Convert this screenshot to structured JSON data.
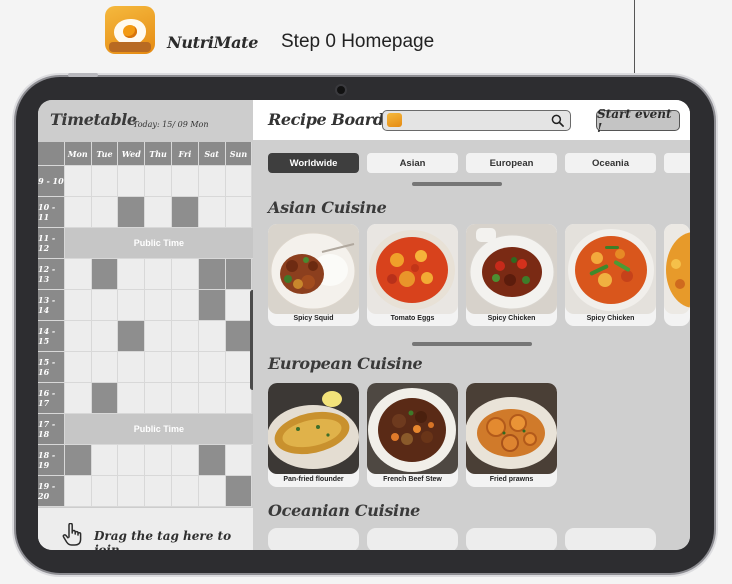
{
  "header": {
    "app_name": "NutriMate",
    "step_title": "Step 0  Homepage"
  },
  "timetable": {
    "title": "Timetable",
    "today": "Today: 15/ 09 Mon",
    "days": [
      "Mon",
      "Tue",
      "Wed",
      "Thu",
      "Fri",
      "Sat",
      "Sun"
    ],
    "public_label": "Public Time",
    "rows": [
      {
        "time": "9 - 10",
        "cells": [
          0,
          0,
          0,
          0,
          0,
          0,
          0
        ]
      },
      {
        "time": "10 - 11",
        "cells": [
          0,
          0,
          1,
          0,
          1,
          0,
          0
        ]
      },
      {
        "time": "11 - 12",
        "public": true
      },
      {
        "time": "12 - 13",
        "cells": [
          0,
          1,
          0,
          0,
          0,
          1,
          1
        ]
      },
      {
        "time": "13 - 14",
        "cells": [
          0,
          0,
          0,
          0,
          0,
          1,
          0
        ]
      },
      {
        "time": "14 - 15",
        "cells": [
          0,
          0,
          1,
          0,
          0,
          0,
          1
        ]
      },
      {
        "time": "15 - 16",
        "cells": [
          0,
          0,
          0,
          0,
          0,
          0,
          0
        ]
      },
      {
        "time": "16 - 17",
        "cells": [
          0,
          1,
          0,
          0,
          0,
          0,
          0
        ]
      },
      {
        "time": "17 - 18",
        "public": true
      },
      {
        "time": "18 - 19",
        "cells": [
          1,
          0,
          0,
          0,
          0,
          1,
          0
        ]
      },
      {
        "time": "19 - 20",
        "cells": [
          0,
          0,
          0,
          0,
          0,
          0,
          1
        ]
      }
    ],
    "drag_hint": "Drag the tag here to join"
  },
  "recipe_board": {
    "title": "Recipe Board",
    "start_label": "Start  event !",
    "tabs": [
      {
        "label": "Worldwide",
        "active": true
      },
      {
        "label": "Asian",
        "active": false
      },
      {
        "label": "European",
        "active": false
      },
      {
        "label": "Oceania",
        "active": false
      },
      {
        "label": "",
        "active": false
      }
    ],
    "sections": [
      {
        "title": "Asian Cuisine",
        "cards": [
          "Spicy Squid",
          "Tomato Eggs",
          "Spicy Chicken",
          "Spicy Chicken",
          ""
        ]
      },
      {
        "title": "European Cuisine",
        "cards": [
          "Pan-fried flounder",
          "French Beef Stew",
          "Fried prawns"
        ]
      },
      {
        "title": "Oceanian Cuisine",
        "cards": [
          "",
          "",
          "",
          ""
        ]
      }
    ]
  },
  "icons": {
    "app": "fried-egg-toast-icon",
    "search": "magnifier-icon",
    "drag": "pointing-hand-icon"
  }
}
